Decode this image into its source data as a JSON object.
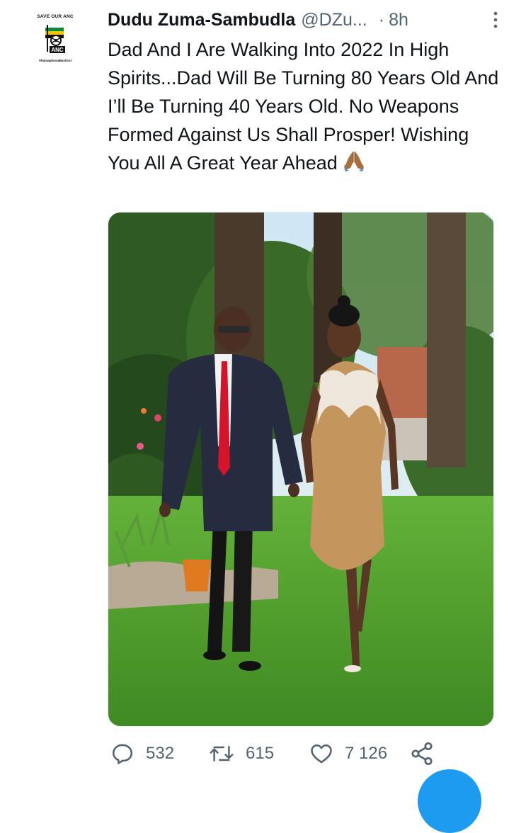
{
  "avatar": {
    "top_text": "SAVE OUR ANC",
    "logo_text": "ANC",
    "bottom_text": "#RamaphosaMustGo!"
  },
  "tweet": {
    "display_name": "Dudu Zuma-Sambudla",
    "handle": "@DZu...",
    "separator": "·",
    "time": "8h",
    "text": "Dad And I Are Walking Into 2022 In High Spirits...Dad Will Be Turning 80 Years Old And I’ll Be Turning 40 Years Old. No Weapons Formed Against Us Shall Prosper! Wishing You All A Great Year Ahead",
    "emoji": "folded-hands",
    "photo_alt": "photo"
  },
  "actions": {
    "reply_count": "532",
    "retweet_count": "615",
    "like_count": "7 126"
  },
  "icons": {
    "more": "more-vertical-icon",
    "reply": "reply-icon",
    "retweet": "retweet-icon",
    "like": "heart-icon",
    "share": "share-icon",
    "compose": "compose-fab"
  },
  "colors": {
    "text": "#0f1419",
    "secondary": "#536471",
    "accent": "#1d9bf0",
    "grass": "#4f9b2c",
    "tie": "#d3142a",
    "dress": "#c4955c"
  }
}
